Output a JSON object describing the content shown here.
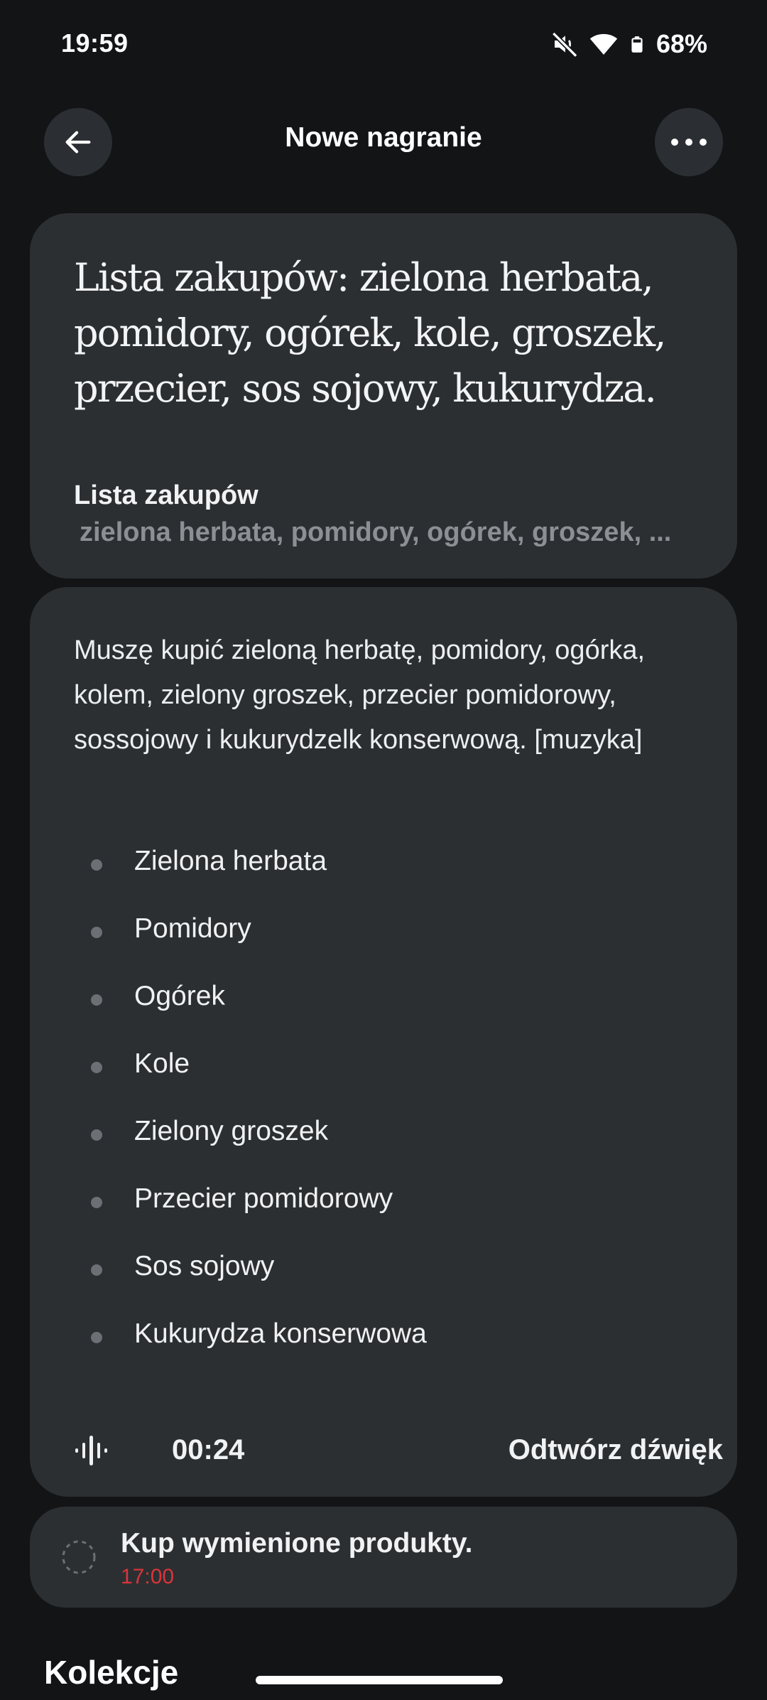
{
  "status_bar": {
    "time": "19:59",
    "battery": "68%",
    "icons": [
      "mute-icon",
      "wifi-icon",
      "battery-icon"
    ]
  },
  "app_bar": {
    "title": "Nowe nagranie",
    "back_icon": "arrow-left-icon",
    "more_icon": "more-horizontal-icon"
  },
  "summary": {
    "headline": "Lista zakupów: zielona herbata, pomidory, ogórek, kole, groszek, przecier, sos sojowy, kukurydza.",
    "note_title": "Lista zakupów",
    "note_preview": "zielona herbata, pomidory, ogórek, groszek, ..."
  },
  "transcript": {
    "text": "Muszę kupić zieloną herbatę, pomidory, ogórka, kolem, zielony groszek, przecier pomidorowy, sossojowy i kukurydzelk konserwową. [muzyka]",
    "items": [
      "Zielona herbata",
      "Pomidory",
      "Ogórek",
      "Kole",
      "Zielony groszek",
      "Przecier pomidorowy",
      "Sos sojowy",
      "Kukurydza konserwowa"
    ],
    "duration": "00:24",
    "play_label": "Odtwórz dźwięk"
  },
  "task": {
    "title": "Kup wymienione produkty.",
    "time": "17:00",
    "time_color": "#d8343a"
  },
  "collections": {
    "heading": "Kolekcje"
  },
  "colors": {
    "background": "#121416",
    "card": "#2c2f32",
    "button": "#2b2f33",
    "muted_text": "#8c9094"
  }
}
